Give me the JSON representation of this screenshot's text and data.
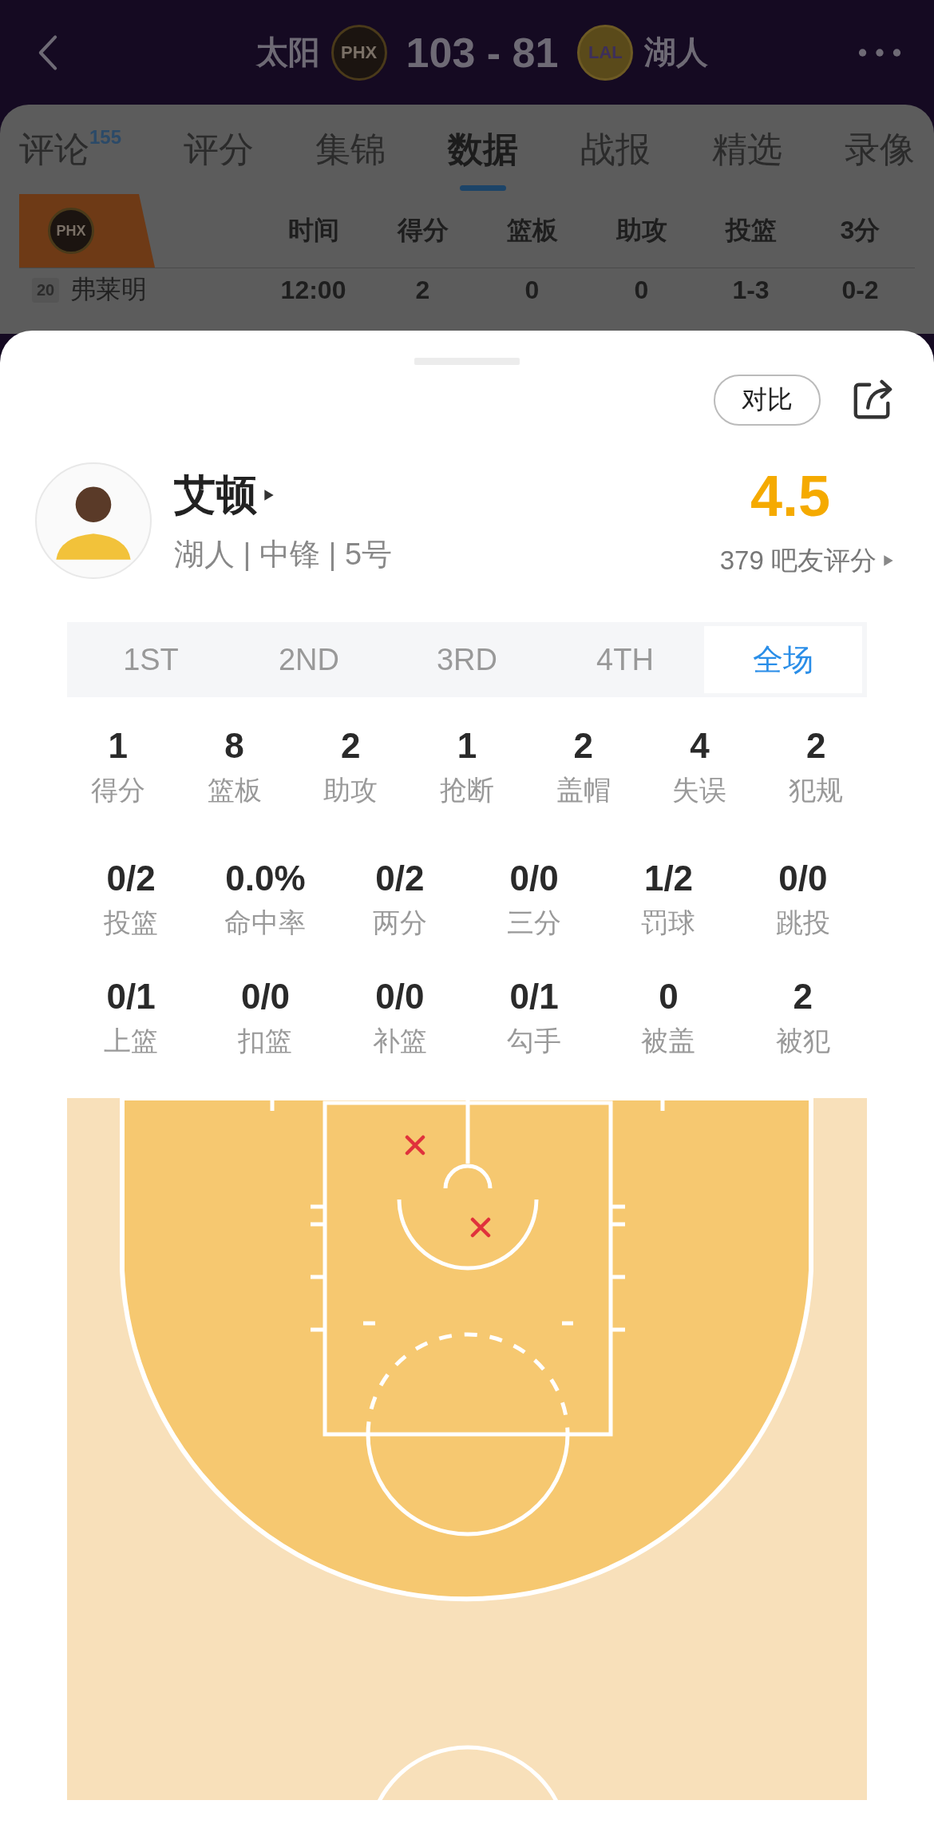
{
  "header": {
    "home_team": "太阳",
    "home_logo": "PHX",
    "score": "103 - 81",
    "away_logo": "LAL",
    "away_team": "湖人"
  },
  "tabs": [
    {
      "label": "评论",
      "badge": "155",
      "selected": false
    },
    {
      "label": "评分",
      "selected": false
    },
    {
      "label": "集锦",
      "selected": false
    },
    {
      "label": "数据",
      "selected": true
    },
    {
      "label": "战报",
      "selected": false
    },
    {
      "label": "精选",
      "selected": false
    },
    {
      "label": "录像",
      "selected": false
    }
  ],
  "boxscore": {
    "team_logo": "PHX",
    "columns": [
      "时间",
      "得分",
      "篮板",
      "助攻",
      "投篮",
      "3分"
    ],
    "row": {
      "number": "20",
      "name": "弗莱明",
      "values": [
        "12:00",
        "2",
        "0",
        "0",
        "1-3",
        "0-2"
      ]
    }
  },
  "player": {
    "compare_button": "对比",
    "name": "艾顿",
    "info": "湖人 | 中锋 | 5号",
    "rating": "4.5",
    "rating_count": "379 吧友评分"
  },
  "periods": [
    {
      "label": "1ST",
      "selected": false
    },
    {
      "label": "2ND",
      "selected": false
    },
    {
      "label": "3RD",
      "selected": false
    },
    {
      "label": "4TH",
      "selected": false
    },
    {
      "label": "全场",
      "selected": true
    }
  ],
  "stats_main": [
    {
      "value": "1",
      "label": "得分"
    },
    {
      "value": "8",
      "label": "篮板"
    },
    {
      "value": "2",
      "label": "助攻"
    },
    {
      "value": "1",
      "label": "抢断"
    },
    {
      "value": "2",
      "label": "盖帽"
    },
    {
      "value": "4",
      "label": "失误"
    },
    {
      "value": "2",
      "label": "犯规"
    }
  ],
  "stats_shooting": [
    {
      "value": "0/2",
      "label": "投篮"
    },
    {
      "value": "0.0%",
      "label": "命中率"
    },
    {
      "value": "0/2",
      "label": "两分"
    },
    {
      "value": "0/0",
      "label": "三分"
    },
    {
      "value": "1/2",
      "label": "罚球"
    },
    {
      "value": "0/0",
      "label": "跳投"
    },
    {
      "value": "0/1",
      "label": "上篮"
    },
    {
      "value": "0/0",
      "label": "扣篮"
    },
    {
      "value": "0/0",
      "label": "补篮"
    },
    {
      "value": "0/1",
      "label": "勾手"
    },
    {
      "value": "0",
      "label": "被盖"
    },
    {
      "value": "2",
      "label": "被犯"
    }
  ],
  "shots": [
    {
      "made": false
    },
    {
      "made": false
    }
  ]
}
